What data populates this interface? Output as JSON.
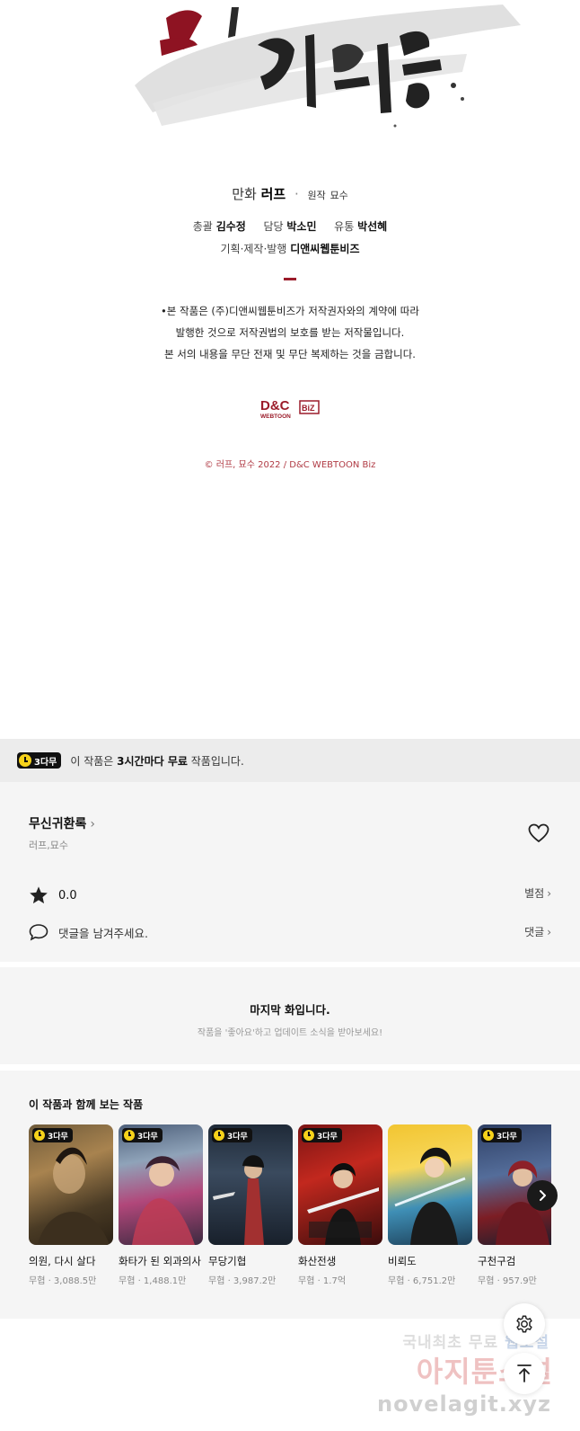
{
  "credits": {
    "manhwa_label": "만화",
    "manhwa_name": "러프",
    "separator": "·",
    "original_label": "원작",
    "original_name": "묘수",
    "chief_label": "총괄",
    "chief_name": "김수정",
    "manager_label": "담당",
    "manager_name": "박소민",
    "distribution_label": "유통",
    "distribution_name": "박선혜",
    "production_label": "기획·제작·발행",
    "production_name": "디앤씨웹툰비즈",
    "notice_lines": [
      "•본 작품은 (주)디앤씨웹툰비즈가 저작권자와의 계약에 따라",
      "발행한 것으로 저작권법의 보호를 받는 저작물입니다.",
      "본 서의 내용을 무단 전재 및 무단 복제하는 것을 금합니다."
    ],
    "logo_text_main": "D&C",
    "logo_text_sub": "WEBTOON",
    "logo_text_biz": "BiZ",
    "copyright": "© 러프, 묘수 2022 / D&C WEBTOON Biz"
  },
  "free_bar": {
    "badge": "3다무",
    "text_before": "이 작품은 ",
    "text_bold": "3시간마다 무료",
    "text_after": " 작품입니다."
  },
  "work": {
    "title": "무신귀환록",
    "title_chevron": "›",
    "authors": "러프,묘수",
    "rating": "0.0",
    "rating_link": "별점",
    "comment_placeholder": "댓글을 남겨주세요.",
    "comment_link": "댓글",
    "link_chevron": "›"
  },
  "last_episode": {
    "title": "마지막 화입니다.",
    "subtitle": "작품을 '좋아요'하고 업데이트 소식을 받아보세요!"
  },
  "recommend": {
    "title": "이 작품과 함께 보는 작품",
    "items": [
      {
        "badge": "3다무",
        "title": "의원, 다시 살다",
        "meta": "무협 · 3,088.5만"
      },
      {
        "badge": "3다무",
        "title": "화타가 된 외과의사",
        "meta": "무협 · 1,488.1만"
      },
      {
        "badge": "3다무",
        "title": "무당기협",
        "meta": "무협 · 3,987.2만"
      },
      {
        "badge": "3다무",
        "title": "화산전생",
        "meta": "무협 · 1.7억"
      },
      {
        "badge": "",
        "title": "비뢰도",
        "meta": "무협 · 6,751.2만"
      },
      {
        "badge": "3다무",
        "title": "구천구검",
        "meta": "무협 · 957.9만"
      }
    ]
  },
  "watermark": {
    "line1_a": "국내최초 무료",
    "line1_b": "웹소설",
    "line2": "아지툰소설",
    "line3": "novelagit.xyz"
  },
  "colors": {
    "accent_red": "#9b1c2a",
    "badge_yellow": "#f6d21a",
    "panel_bg": "#f5f5f5"
  }
}
